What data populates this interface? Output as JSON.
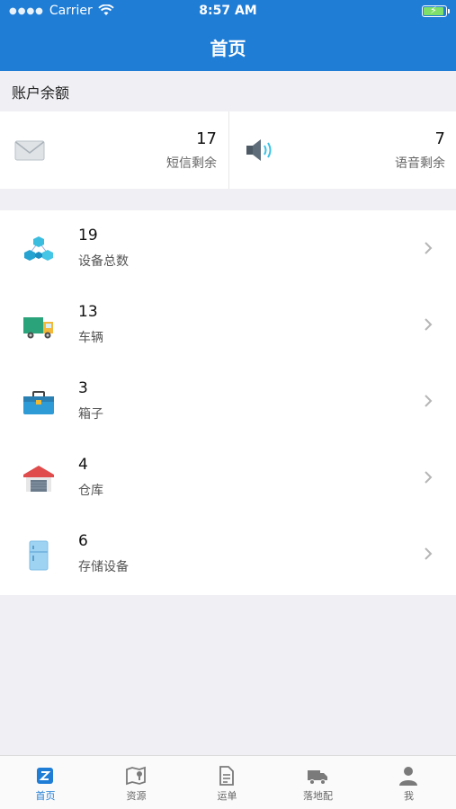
{
  "status_bar": {
    "carrier": "Carrier",
    "time": "8:57 AM"
  },
  "header": {
    "title": "首页"
  },
  "balance": {
    "section_title": "账户余额",
    "sms": {
      "value": "17",
      "label": "短信剩余",
      "icon": "envelope-icon"
    },
    "voice": {
      "value": "7",
      "label": "语音剩余",
      "icon": "speaker-icon"
    }
  },
  "resources": [
    {
      "value": "19",
      "label": "设备总数",
      "icon": "device-network-icon"
    },
    {
      "value": "13",
      "label": "车辆",
      "icon": "truck-icon"
    },
    {
      "value": "3",
      "label": "箱子",
      "icon": "toolbox-icon"
    },
    {
      "value": "4",
      "label": "仓库",
      "icon": "warehouse-icon"
    },
    {
      "value": "6",
      "label": "存储设备",
      "icon": "fridge-icon"
    }
  ],
  "tabs": [
    {
      "label": "首页",
      "icon": "home-z-icon",
      "active": true
    },
    {
      "label": "资源",
      "icon": "map-pin-icon"
    },
    {
      "label": "运单",
      "icon": "document-icon"
    },
    {
      "label": "落地配",
      "icon": "delivery-truck-icon"
    },
    {
      "label": "我",
      "icon": "user-icon"
    }
  ],
  "colors": {
    "primary": "#1f7dd6",
    "background": "#efeff4"
  }
}
